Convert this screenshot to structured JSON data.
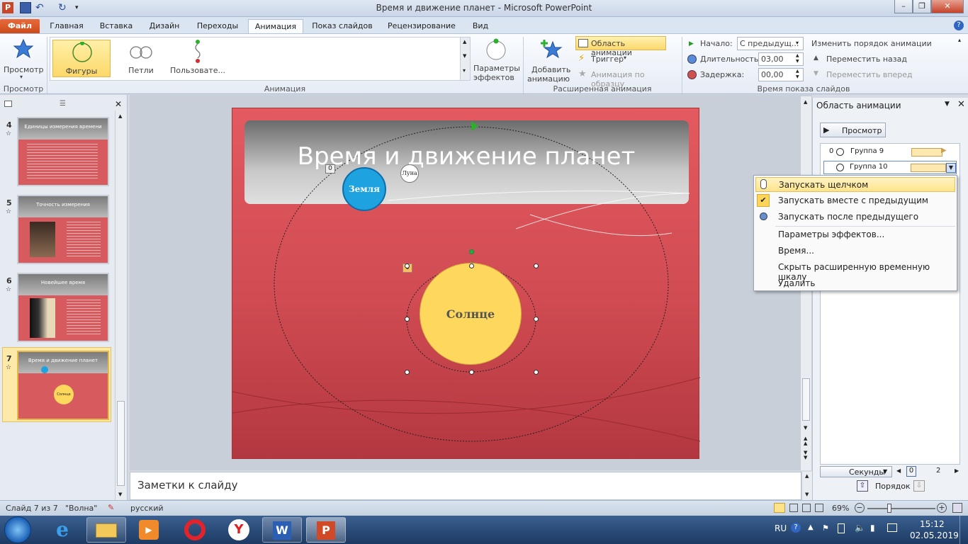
{
  "window": {
    "title": "Время и движение планет - Microsoft PowerPoint",
    "min": "–",
    "max": "❐",
    "close": "✕"
  },
  "tabs": [
    "Файл",
    "Главная",
    "Вставка",
    "Дизайн",
    "Переходы",
    "Анимация",
    "Показ слайдов",
    "Рецензирование",
    "Вид"
  ],
  "ribbon": {
    "preview": "Просмотр",
    "shapes": "Фигуры",
    "loops": "Петли",
    "custom": "Пользовате...",
    "effect_params_1": "Параметры",
    "effect_params_2": "эффектов",
    "add_anim_1": "Добавить",
    "add_anim_2": "анимацию",
    "anim_pane": "Область анимации",
    "trigger": "Триггер",
    "anim_painter": "Анимация по образцу",
    "start_label": "Начало:",
    "start_value": "С предыдущ...",
    "duration_label": "Длительность:",
    "duration_value": "03,00",
    "delay_label": "Задержка:",
    "delay_value": "00,00",
    "reorder": "Изменить порядок анимации",
    "move_back": "Переместить назад",
    "move_fwd": "Переместить вперед",
    "group_preview": "Просмотр",
    "group_anim": "Анимация",
    "group_adv": "Расширенная анимация",
    "group_timing": "Время показа слайдов"
  },
  "slides": [
    {
      "num": "4",
      "title": "Единицы измерения времени"
    },
    {
      "num": "5",
      "title": "Точность измерения"
    },
    {
      "num": "6",
      "title": "Новейшее время"
    },
    {
      "num": "7",
      "title": "Время и движение планет",
      "sun": "Солнце"
    }
  ],
  "slide": {
    "title": "Время и движение планет",
    "earth": "Земля",
    "moon": "Луна",
    "sun": "Солнце",
    "tag0": "0",
    "tag1": "0"
  },
  "notes": "Заметки к слайду",
  "animpane": {
    "title": "Область анимации",
    "play": "Просмотр",
    "items": [
      {
        "num": "0",
        "name": "Группа 9"
      },
      {
        "num": "",
        "name": "Группа 10"
      }
    ],
    "seconds": "Секунды",
    "tick0": "0",
    "tick2": "2",
    "order": "Порядок"
  },
  "context_menu": [
    "Запускать щелчком",
    "Запускать вместе с предыдущим",
    "Запускать после предыдущего",
    "Параметры эффектов...",
    "Время...",
    "Скрыть расширенную временную шкалу",
    "Удалить"
  ],
  "status": {
    "slide": "Слайд 7 из 7",
    "theme": "\"Волна\"",
    "lang": "русский",
    "zoom": "69%"
  },
  "taskbar": {
    "lang": "RU",
    "time": "15:12",
    "date": "02.05.2019"
  },
  "colors": {
    "file_tab": "#d2542a",
    "highlight": "#fde48a",
    "earth": "#1ea2e0",
    "sun": "#fdd85d",
    "slide": "#d84f56"
  }
}
